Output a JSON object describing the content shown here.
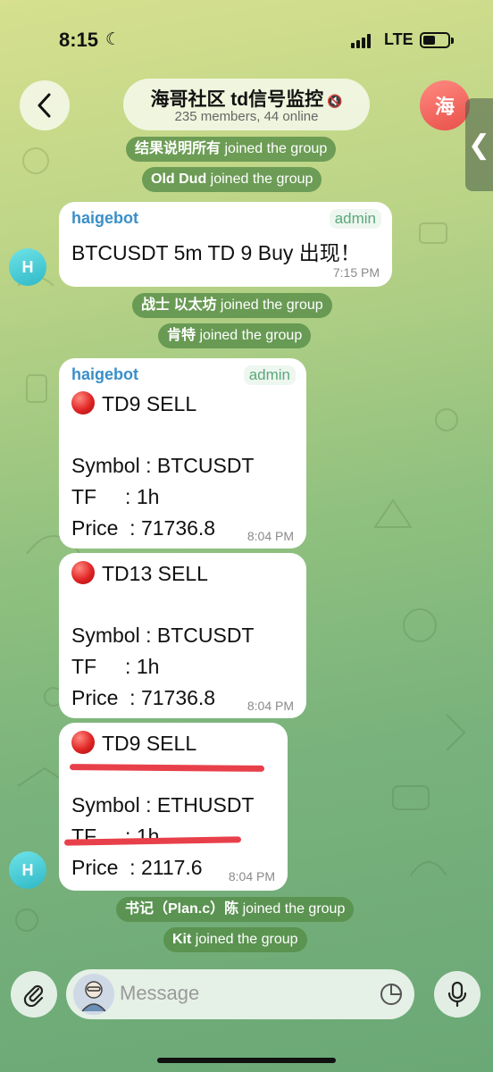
{
  "status_bar": {
    "time": "8:15",
    "network": "LTE"
  },
  "header": {
    "title": "海哥社区 td信号监控",
    "subtitle": "235 members, 44 online",
    "avatar_initial": "海",
    "back_icon": "chevron-left-icon",
    "mute_icon": "speaker-muted-icon"
  },
  "messages": {
    "svc1": {
      "name": "结果说明所有",
      "text": "joined the group"
    },
    "svc2": {
      "name": "Old Dud",
      "text": "joined the group"
    },
    "m1": {
      "sender": "haigebot",
      "badge": "admin",
      "text": "BTCUSDT 5m TD 9 Buy 出现！",
      "time": "7:15 PM",
      "avatar_initial": "H"
    },
    "svc3": {
      "name": "战士 以太坊",
      "text": "joined the group"
    },
    "svc4": {
      "name": "肯特",
      "text": "joined the group"
    },
    "m2": {
      "sender": "haigebot",
      "badge": "admin",
      "signal": "TD9 SELL",
      "symbol_line": "Symbol : BTCUSDT",
      "tf_line": "TF     : 1h",
      "price_line": "Price  : 71736.8",
      "time": "8:04 PM"
    },
    "m3": {
      "signal": "TD13 SELL",
      "symbol_line": "Symbol : BTCUSDT",
      "tf_line": "TF     : 1h",
      "price_line": "Price  : 71736.8",
      "time": "8:04 PM"
    },
    "m4": {
      "signal": "TD9 SELL",
      "symbol_line": "Symbol : ETHUSDT",
      "tf_line": "TF     : 1h",
      "price_line": "Price  : 2117.6",
      "time": "8:04 PM",
      "avatar_initial": "H"
    },
    "svc5": {
      "name": "书记（Plan.c）陈",
      "text": "joined the group"
    },
    "svc6": {
      "name": "Kit",
      "text": "joined the group"
    }
  },
  "composer": {
    "placeholder": "Message"
  },
  "colors": {
    "sender": "#3a8fc9",
    "service_bg": "#558c46",
    "signal_dot": "#e02424",
    "annotation": "#e8404a"
  }
}
